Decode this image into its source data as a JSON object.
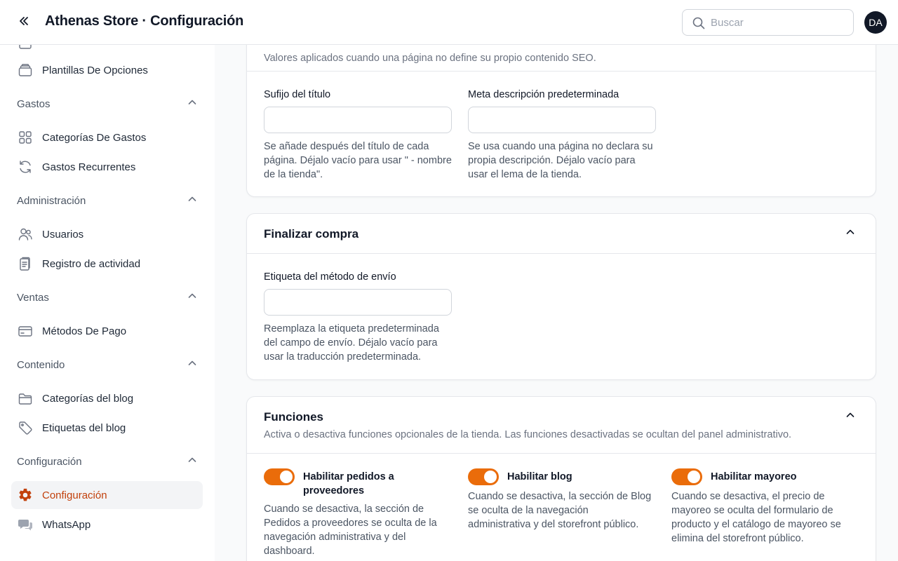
{
  "header": {
    "title": "Athenas Store · Configuración",
    "search_placeholder": "Buscar",
    "avatar_initials": "DA"
  },
  "sidebar": {
    "items_top": [
      {
        "label": "Plantillas De Opciones",
        "icon": "stack-icon"
      }
    ],
    "groups": [
      {
        "label": "Gastos",
        "items": [
          {
            "label": "Categorías De Gastos",
            "icon": "grid-icon"
          },
          {
            "label": "Gastos Recurrentes",
            "icon": "refresh-icon"
          }
        ]
      },
      {
        "label": "Administración",
        "items": [
          {
            "label": "Usuarios",
            "icon": "users-icon"
          },
          {
            "label": "Registro de actividad",
            "icon": "clipboard-icon"
          }
        ]
      },
      {
        "label": "Ventas",
        "items": [
          {
            "label": "Métodos De Pago",
            "icon": "credit-card-icon"
          }
        ]
      },
      {
        "label": "Contenido",
        "items": [
          {
            "label": "Categorías del blog",
            "icon": "folder-icon"
          },
          {
            "label": "Etiquetas del blog",
            "icon": "tag-icon"
          }
        ]
      },
      {
        "label": "Configuración",
        "items": [
          {
            "label": "Configuración",
            "icon": "gear-icon",
            "active": true
          },
          {
            "label": "WhatsApp",
            "icon": "chat-icon"
          }
        ]
      }
    ]
  },
  "seo": {
    "description": "Valores aplicados cuando una página no define su propio contenido SEO.",
    "title_suffix": {
      "label": "Sufijo del título",
      "value": "",
      "help": "Se añade después del título de cada página. Déjalo vacío para usar \" - nombre de la tienda\"."
    },
    "meta_description": {
      "label": "Meta descripción predeterminada",
      "value": "",
      "help": "Se usa cuando una página no declara su propia descripción. Déjalo vacío para usar el lema de la tienda."
    }
  },
  "checkout": {
    "title": "Finalizar compra",
    "shipping_label": {
      "label": "Etiqueta del método de envío",
      "value": "",
      "help": "Reemplaza la etiqueta predeterminada del campo de envío. Déjalo vacío para usar la traducción predeterminada."
    }
  },
  "features": {
    "title": "Funciones",
    "description": "Activa o desactiva funciones opcionales de la tienda. Las funciones desactivadas se ocultan del panel administrativo.",
    "toggles": [
      {
        "label": "Habilitar pedidos a proveedores",
        "enabled": true,
        "help": "Cuando se desactiva, la sección de Pedidos a proveedores se oculta de la navegación administrativa y del dashboard."
      },
      {
        "label": "Habilitar blog",
        "enabled": true,
        "help": "Cuando se desactiva, la sección de Blog se oculta de la navegación administrativa y del storefront público."
      },
      {
        "label": "Habilitar mayoreo",
        "enabled": true,
        "help": "Cuando se desactiva, el precio de mayoreo se oculta del formulario de producto y el catálogo de mayoreo se elimina del storefront público."
      }
    ]
  },
  "colors": {
    "accent": "#ea6c0a",
    "active_text": "#c2410c"
  }
}
